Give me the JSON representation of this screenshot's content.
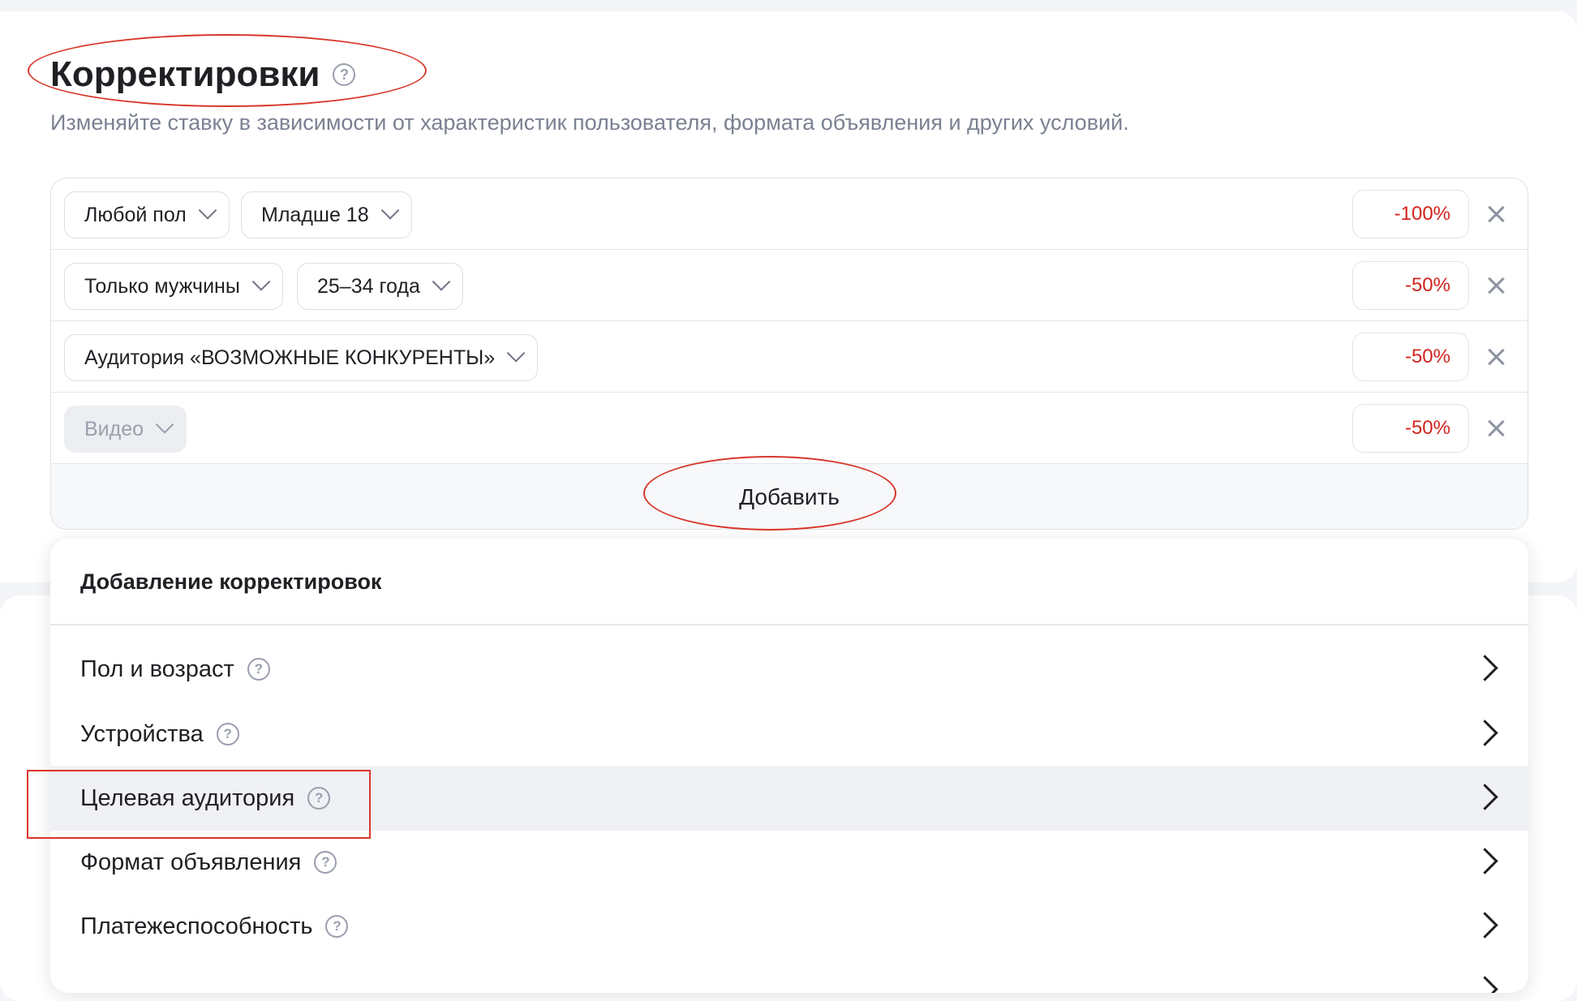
{
  "header": {
    "title": "Корректировки",
    "subtitle": "Изменяйте ставку в зависимости от характеристик пользователя, формата объявления и других условий."
  },
  "rules": [
    {
      "chips": [
        "Любой пол",
        "Младше 18"
      ],
      "value": "-100%",
      "disabled": false
    },
    {
      "chips": [
        "Только мужчины",
        "25–34 года"
      ],
      "value": "-50%",
      "disabled": false
    },
    {
      "chips": [
        "Аудитория «ВОЗМОЖНЫЕ КОНКУРЕНТЫ»"
      ],
      "value": "-50%",
      "disabled": false
    },
    {
      "chips": [
        "Видео"
      ],
      "value": "-50%",
      "disabled": true
    }
  ],
  "add_button": "Добавить",
  "popup": {
    "title": "Добавление корректировок",
    "items": [
      {
        "label": "Пол и возраст",
        "highlighted": false
      },
      {
        "label": "Устройства",
        "highlighted": false
      },
      {
        "label": "Целевая аудитория",
        "highlighted": true
      },
      {
        "label": "Формат объявления",
        "highlighted": false
      },
      {
        "label": "Платежеспособность",
        "highlighted": false
      }
    ]
  },
  "colors": {
    "negative_value": "#d1241c",
    "annotation": "#d8362a",
    "highlight_row": "#f0f1f5"
  }
}
